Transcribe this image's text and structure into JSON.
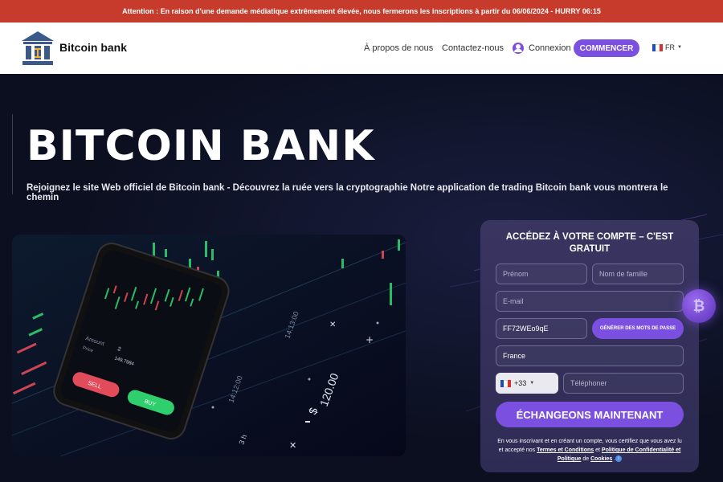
{
  "alert": {
    "text": "Attention : En raison d'une demande médiatique extrêmement élevée, nous fermerons les inscriptions à partir du 06/06/2024 - HURRY 06:15"
  },
  "header": {
    "logo_text": "Bitcoin bank",
    "nav": {
      "about": "À propos de nous",
      "contact": "Contactez-nous",
      "login": "Connexion"
    },
    "start_label": "COMMENCER",
    "lang": "FR"
  },
  "hero": {
    "title": "BITCOIN BANK",
    "subtitle": "Rejoignez le site Web officiel de Bitcoin bank - Découvrez la ruée vers la cryptographie Notre application de trading Bitcoin bank vous montrera le chemin",
    "image": {
      "phone": {
        "amount_label": "Amount",
        "amount_value": "2",
        "price_label": "Price",
        "price_value": "149.7984",
        "sell_label": "SELL",
        "buy_label": "BUY"
      },
      "times": [
        "14:13:00",
        "14:12:00",
        "120.00",
        "3 h"
      ]
    }
  },
  "form": {
    "title": "ACCÉDEZ À VOTRE COMPTE – C'EST GRATUIT",
    "first_name_placeholder": "Prénom",
    "last_name_placeholder": "Nom de famille",
    "email_placeholder": "E-mail",
    "password_value": "FF72WEo9qE",
    "generate_label": "GÉNÉRER DES MOTS DE PASSE",
    "country_value": "France",
    "phone_code": "+33",
    "phone_placeholder": "Téléphoner",
    "submit_label": "ÉCHANGEONS MAINTENANT",
    "disclaimer": {
      "before": "En vous inscrivant et en créant un compte, vous certifiez que vous avez lu et accepté nos ",
      "terms": "Termes et Conditions",
      "and1": " et ",
      "privacy": "Politique de Confidentialité et Politique",
      "de": " de ",
      "cookies": "Cookies",
      "end": " ."
    }
  },
  "colors": {
    "accent": "#7b4fe0",
    "alert": "#c63b2b",
    "background": "#0b0f1f"
  }
}
